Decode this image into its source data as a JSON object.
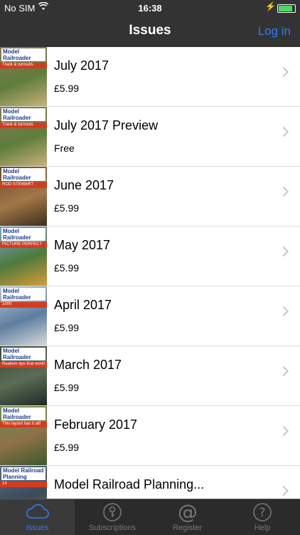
{
  "status": {
    "carrier": "No SIM",
    "time": "16:38"
  },
  "nav": {
    "title": "Issues",
    "login": "Log in"
  },
  "issues": [
    {
      "title": "July 2017",
      "price": "£5.99",
      "cover_mast": "Model Railroader",
      "cover_strap": "Track & turnouts",
      "cover_colors": [
        "#8a7a55",
        "#5e7d3c",
        "#c9b07a"
      ]
    },
    {
      "title": "July 2017 Preview",
      "price": "Free",
      "cover_mast": "Model Railroader",
      "cover_strap": "Track & turnouts",
      "cover_colors": [
        "#8a7a55",
        "#5e7d3c",
        "#c9b07a"
      ]
    },
    {
      "title": "June 2017",
      "price": "£5.99",
      "cover_mast": "Model Railroader",
      "cover_strap": "ROD STEWART",
      "cover_colors": [
        "#6b4a2a",
        "#a27748",
        "#3e2e1c"
      ]
    },
    {
      "title": "May 2017",
      "price": "£5.99",
      "cover_mast": "Model Railroader",
      "cover_strap": "PICTURE PERFECT",
      "cover_colors": [
        "#7aa3c8",
        "#4f7a3b",
        "#d99b3a"
      ]
    },
    {
      "title": "April 2017",
      "price": "£5.99",
      "cover_mast": "Model Railroader",
      "cover_strap": "1000",
      "cover_colors": [
        "#b9c7d4",
        "#5e7ea0",
        "#d8d8d8"
      ]
    },
    {
      "title": "March 2017",
      "price": "£5.99",
      "cover_mast": "Model Railroader",
      "cover_strap": "Realism tips that work!",
      "cover_colors": [
        "#3d4a3a",
        "#5b6b55",
        "#1e2a24"
      ]
    },
    {
      "title": "February 2017",
      "price": "£5.99",
      "cover_mast": "Model Railroader",
      "cover_strap": "This layout has it all!",
      "cover_colors": [
        "#6f8f4a",
        "#8e7048",
        "#3b5a2a"
      ]
    },
    {
      "title": "Model Railroad Planning...",
      "price": "",
      "cover_mast": "Model Railroad Planning",
      "cover_strap": "14",
      "cover_colors": [
        "#5a6a7c",
        "#3c4b5a",
        "#7b8c5a"
      ]
    }
  ],
  "tabs": [
    {
      "label": "Issues",
      "icon": "cloud-icon",
      "active": true
    },
    {
      "label": "Subscriptions",
      "icon": "key-icon",
      "active": false
    },
    {
      "label": "Register",
      "icon": "at-icon",
      "active": false
    },
    {
      "label": "Help",
      "icon": "question-icon",
      "active": false
    }
  ],
  "colors": {
    "accent": "#2f7cf6",
    "bar": "#333333",
    "battery": "#4cd964"
  }
}
